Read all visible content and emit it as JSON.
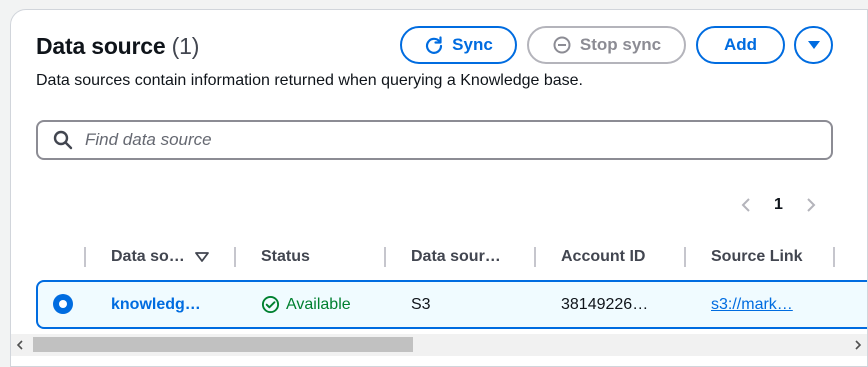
{
  "header": {
    "title": "Data source",
    "count": "(1)",
    "description": "Data sources contain information returned when querying a Knowledge base."
  },
  "actions": {
    "sync_label": "Sync",
    "stop_sync_label": "Stop sync",
    "add_label": "Add"
  },
  "search": {
    "placeholder": "Find data source",
    "value": ""
  },
  "pagination": {
    "current_page": "1"
  },
  "table": {
    "columns": [
      "Data so…",
      "Status",
      "Data sour…",
      "Account ID",
      "Source Link"
    ],
    "rows": [
      {
        "selected": true,
        "name": "knowledg…",
        "status": "Available",
        "type": "S3",
        "account_id": "38149226…",
        "source_link": "s3://mark…"
      }
    ]
  },
  "colors": {
    "accent": "#006ce0",
    "success": "#00802f",
    "selected_row_bg": "#f0fbff",
    "disabled": "#8c8c94"
  },
  "icons": {
    "sync": "refresh-icon",
    "stop_sync": "stop-circle-icon",
    "more": "caret-down-icon",
    "search": "search-icon",
    "status_ok": "check-circle-icon"
  }
}
